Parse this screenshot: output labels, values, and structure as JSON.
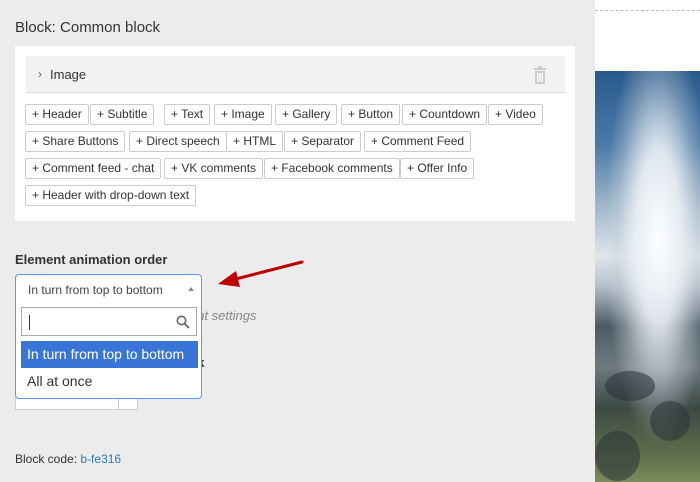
{
  "block": {
    "title": "Block: Common block"
  },
  "image_row": {
    "label": "Image",
    "chevron": "chevron-right-icon",
    "delete_icon": "trash-icon"
  },
  "add_buttons": [
    "+ Header",
    "+ Subtitle",
    "+ Text",
    "+ Image",
    "+ Gallery",
    "+ Button",
    "+ Countdown",
    "+ Video",
    "+ Share Buttons",
    "+ Direct speech",
    "+ HTML",
    "+ Separator",
    "+ Comment Feed",
    "+ Comment feed - chat",
    "+ VK comments",
    "+ Facebook comments",
    "+ Offer Info",
    "+ Header with drop-down text"
  ],
  "animation": {
    "label": "Element animation order",
    "selected": "In turn from top to bottom",
    "search_value": "",
    "options": [
      "In turn from top to bottom",
      "All at once"
    ]
  },
  "obscured": {
    "settings_fragment": "ent settings",
    "bold_fragment": "ck"
  },
  "block_code": {
    "label": "Block code:",
    "value": "b-fe316"
  },
  "colors": {
    "accent": "#3875d7",
    "focus_border": "#5897fb",
    "link": "#2a7ab8",
    "annotation_arrow": "#c00000"
  }
}
